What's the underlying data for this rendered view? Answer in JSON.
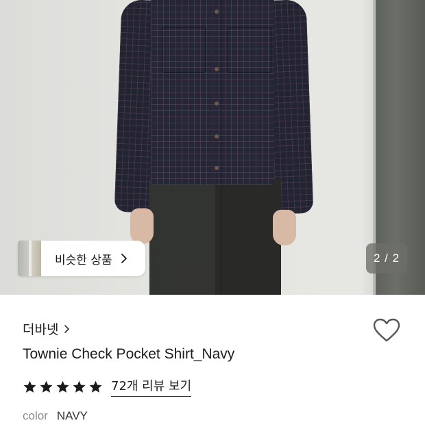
{
  "gallery": {
    "similar_label": "비슷한 상품",
    "pager_text": "2 / 2"
  },
  "product": {
    "brand": "더바넷",
    "title": "Townie Check Pocket Shirt_Navy",
    "rating_stars": 5,
    "review_link": "72개 리뷰 보기",
    "color_label": "color",
    "color_value": "NAVY"
  },
  "colors": {
    "star": "#1a1a1a",
    "pager_bg": "#6e6e69",
    "heart_stroke": "#555555"
  },
  "icons": {
    "similar_arrow": "chevron-right-icon",
    "brand_arrow": "chevron-right-icon",
    "wishlist": "heart-outline-icon",
    "star": "star-icon"
  }
}
